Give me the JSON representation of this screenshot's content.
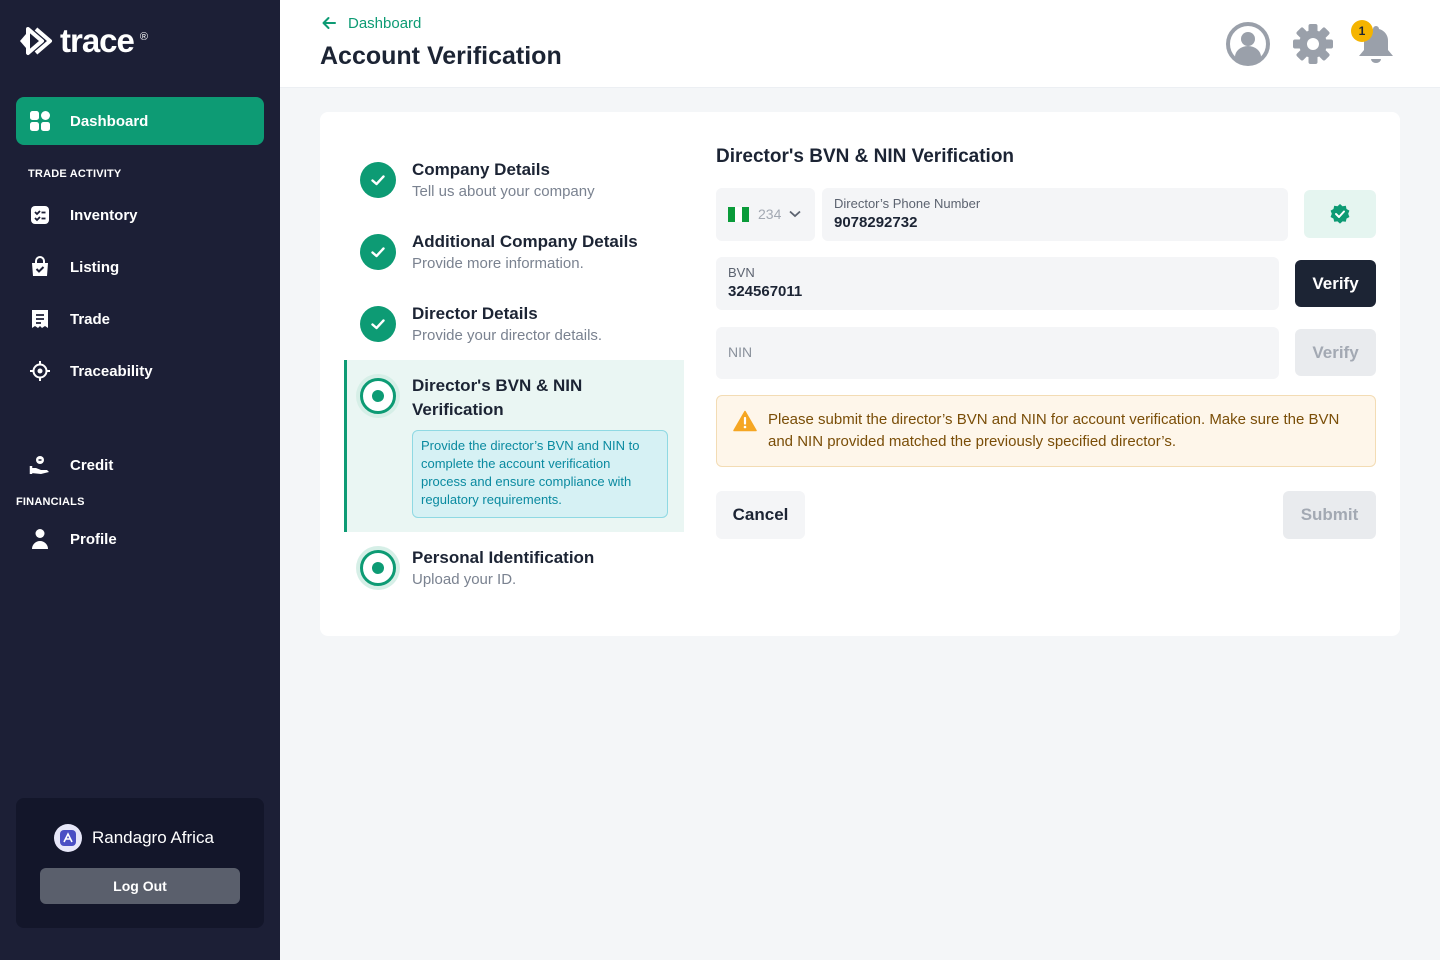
{
  "brand": {
    "name": "trace",
    "reg_mark": "®"
  },
  "sidebar": {
    "dashboard": "Dashboard",
    "trade_activity_label": "TRADE ACTIVITY",
    "items": [
      {
        "label": "Inventory",
        "icon": "inventory-icon"
      },
      {
        "label": "Listing",
        "icon": "shopping-bag-icon"
      },
      {
        "label": "Trade",
        "icon": "receipt-icon"
      },
      {
        "label": "Traceability",
        "icon": "target-icon"
      }
    ],
    "credit": "Credit",
    "financials_label": "FINANCIALS",
    "profile": "Profile",
    "account_name": "Randagro Africa",
    "logout": "Log Out"
  },
  "header": {
    "back_label": "Dashboard",
    "title": "Account Verification",
    "notification_count": "1"
  },
  "steps": [
    {
      "title": "Company Details",
      "subtitle": "Tell us about your company",
      "status": "done"
    },
    {
      "title": "Additional Company Details",
      "subtitle": "Provide more information.",
      "status": "done"
    },
    {
      "title": "Director Details",
      "subtitle": "Provide your director details.",
      "status": "done"
    },
    {
      "title": "Director's BVN & NIN Verification",
      "hint": "Provide the director’s BVN and NIN to complete the account verification process and ensure compliance with regulatory requirements.",
      "status": "current"
    },
    {
      "title": "Personal Identification",
      "subtitle": "Upload your ID.",
      "status": "pending"
    }
  ],
  "form": {
    "title": "Director's BVN & NIN Verification",
    "country_code": "234",
    "phone_label": "Director’s Phone Number",
    "phone_value": "9078292732",
    "bvn_label": "BVN",
    "bvn_value": "324567011",
    "nin_placeholder": "NIN",
    "verify_label": "Verify",
    "alert": "Please submit the director’s BVN and NIN for account verification. Make sure the BVN and NIN provided matched the previously specified director’s.",
    "cancel": "Cancel",
    "submit": "Submit"
  },
  "colors": {
    "accent": "#0d9b74",
    "sidebar": "#1c1f36",
    "dark_button": "#1c2434",
    "warning": "#f5a623"
  }
}
